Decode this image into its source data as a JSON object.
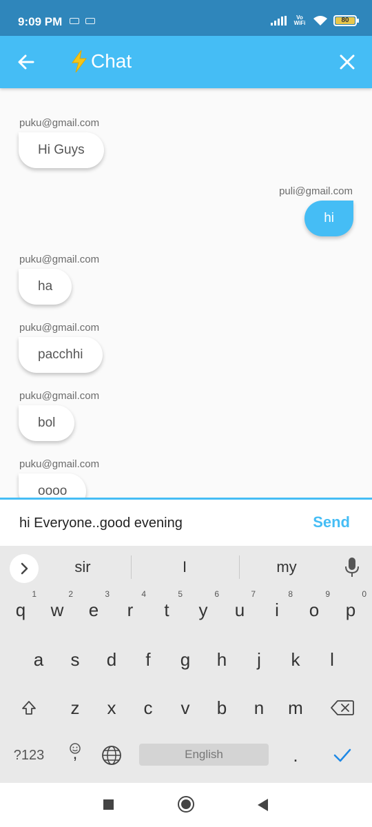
{
  "status_bar": {
    "time": "9:09 PM",
    "network": "Vo WiFi",
    "battery": "80",
    "icons": [
      "signal-icon",
      "wifi-icon",
      "battery-icon"
    ]
  },
  "app_bar": {
    "title": "Chat",
    "icons": {
      "back": "arrow-back-icon",
      "title": "lightning-bolt-icon",
      "close": "close-icon"
    },
    "background": "#45bdf5"
  },
  "messages": [
    {
      "sender": "puku@gmail.com",
      "text": "Hi Guys",
      "align": "left"
    },
    {
      "sender": "puli@gmail.com",
      "text": "hi",
      "align": "right"
    },
    {
      "sender": "puku@gmail.com",
      "text": "ha",
      "align": "left"
    },
    {
      "sender": "puku@gmail.com",
      "text": "pacchhi",
      "align": "left"
    },
    {
      "sender": "puku@gmail.com",
      "text": "bol",
      "align": "left"
    },
    {
      "sender": "puku@gmail.com",
      "text": "oooo",
      "align": "left"
    }
  ],
  "composer": {
    "value": "hi Everyone..good evening",
    "send_label": "Send"
  },
  "keyboard": {
    "suggestions": [
      "sir",
      "I",
      "my"
    ],
    "row1": [
      "q",
      "w",
      "e",
      "r",
      "t",
      "y",
      "u",
      "i",
      "o",
      "p"
    ],
    "row1_hints": [
      "1",
      "2",
      "3",
      "4",
      "5",
      "6",
      "7",
      "8",
      "9",
      "0"
    ],
    "row2": [
      "a",
      "s",
      "d",
      "f",
      "g",
      "h",
      "j",
      "k",
      "l"
    ],
    "row3": [
      "z",
      "x",
      "c",
      "v",
      "b",
      "n",
      "m"
    ],
    "symbols_label": "?123",
    "spacebar_label": "English",
    "period_label": ".",
    "comma_label": ",",
    "accent_color": "#1e88e5"
  },
  "nav_bar": {
    "icons": [
      "recents-icon",
      "home-icon",
      "back-icon"
    ]
  }
}
